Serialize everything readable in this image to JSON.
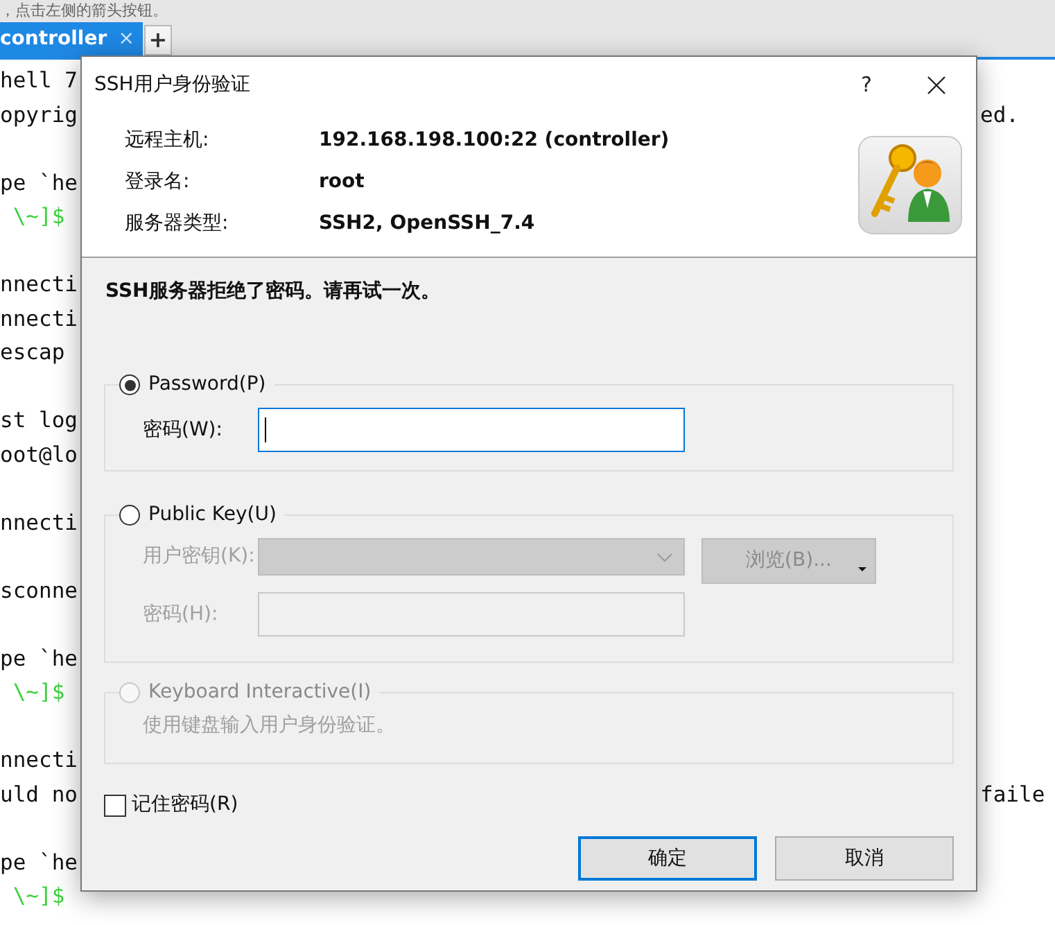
{
  "hint": "，点击左侧的箭头按钮。",
  "tabs": [
    {
      "label": "controller",
      "close": "×",
      "selected": true
    }
  ],
  "add_tab": "+",
  "terminal": {
    "lines": [
      {
        "left": "hell 7",
        "kind": "text"
      },
      {
        "left": "opyrig",
        "right": "ed.",
        "kind": "text"
      },
      {
        "kind": "blank"
      },
      {
        "left": "pe `he",
        "kind": "text"
      },
      {
        "left": " \\~]$",
        "kind": "prompt"
      },
      {
        "kind": "blank"
      },
      {
        "left": "nnecti",
        "kind": "text"
      },
      {
        "left": "nnecti",
        "kind": "text"
      },
      {
        "left": "escap",
        "kind": "text"
      },
      {
        "kind": "blank"
      },
      {
        "left": "st log",
        "kind": "text"
      },
      {
        "left": "oot@lo",
        "kind": "text"
      },
      {
        "kind": "blank"
      },
      {
        "left": "nnecti",
        "kind": "text"
      },
      {
        "kind": "blank"
      },
      {
        "left": "sconne",
        "kind": "text"
      },
      {
        "kind": "blank"
      },
      {
        "left": "pe `he",
        "kind": "text"
      },
      {
        "left": " \\~]$",
        "kind": "prompt"
      },
      {
        "kind": "blank"
      },
      {
        "left": "nnecti",
        "kind": "text"
      },
      {
        "left": "uld no",
        "right": "faile",
        "kind": "text"
      },
      {
        "kind": "blank"
      },
      {
        "left": "pe `he",
        "kind": "text"
      },
      {
        "left": " \\~]$",
        "kind": "prompt"
      }
    ]
  },
  "dialog": {
    "title": "SSH用户身份验证",
    "help": "?",
    "info": [
      {
        "label": "远程主机:",
        "value": "192.168.198.100:22 (controller)"
      },
      {
        "label": "登录名:",
        "value": "root"
      },
      {
        "label": "服务器类型:",
        "value": "SSH2, OpenSSH_7.4"
      }
    ],
    "message": "SSH服务器拒绝了密码。请再试一次。",
    "methods": [
      {
        "kind": "password",
        "label": "Password(P)",
        "selected": true,
        "disabled": false,
        "field_label": "密码(W):"
      },
      {
        "kind": "publickey",
        "label": "Public Key(U)",
        "selected": false,
        "disabled": false,
        "key_label": "用户密钥(K):",
        "browse": "浏览(B)...",
        "field_label": "密码(H):"
      },
      {
        "kind": "keyboard",
        "label": "Keyboard Interactive(I)",
        "selected": false,
        "disabled": true,
        "note": "使用键盘输入用户身份验证。"
      }
    ],
    "remember": {
      "label": "记住密码(R)",
      "checked": false
    },
    "buttons": [
      {
        "label": "确定",
        "default": true
      },
      {
        "label": "取消",
        "default": false
      }
    ]
  }
}
